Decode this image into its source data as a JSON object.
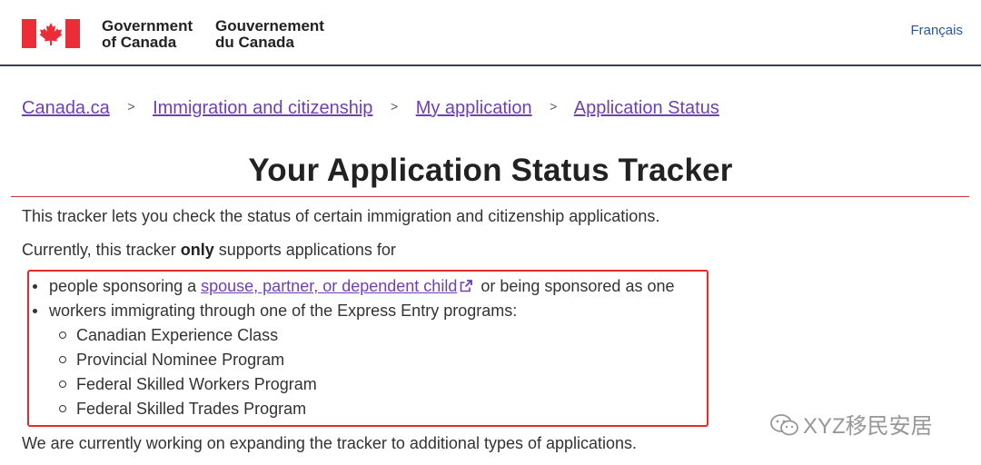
{
  "header": {
    "signature_en": [
      "Government",
      "of Canada"
    ],
    "signature_fr": [
      "Gouvernement",
      "du Canada"
    ],
    "language_link": "Français"
  },
  "breadcrumb": {
    "separator": ">",
    "items": [
      "Canada.ca",
      "Immigration and citizenship",
      "My application",
      "Application Status"
    ]
  },
  "main": {
    "title": "Your Application Status Tracker",
    "intro": "This tracker lets you check the status of certain immigration and citizenship applications.",
    "currently_before": "Currently, this tracker ",
    "currently_bold": "only",
    "currently_after": " supports applications for",
    "list": {
      "item1_before": "people sponsoring a ",
      "item1_link": "spouse, partner, or dependent child",
      "item1_after": " or being sponsored as one",
      "item2": "workers immigrating through one of the Express Entry programs:",
      "programs": [
        "Canadian Experience Class",
        "Provincial Nominee Program",
        "Federal Skilled Workers Program",
        "Federal Skilled Trades Program"
      ]
    },
    "footer_note": "We are currently working on expanding the tracker to additional types of applications."
  },
  "watermark": "XYZ移民安居",
  "colors": {
    "flag_red": "#eb2d37",
    "link_visited": "#6f3fb5",
    "highlight_border": "#e32b2b",
    "title_rule": "#c7343b"
  },
  "icons": [
    "canada-flag-icon",
    "external-link-icon",
    "wechat-icon"
  ]
}
